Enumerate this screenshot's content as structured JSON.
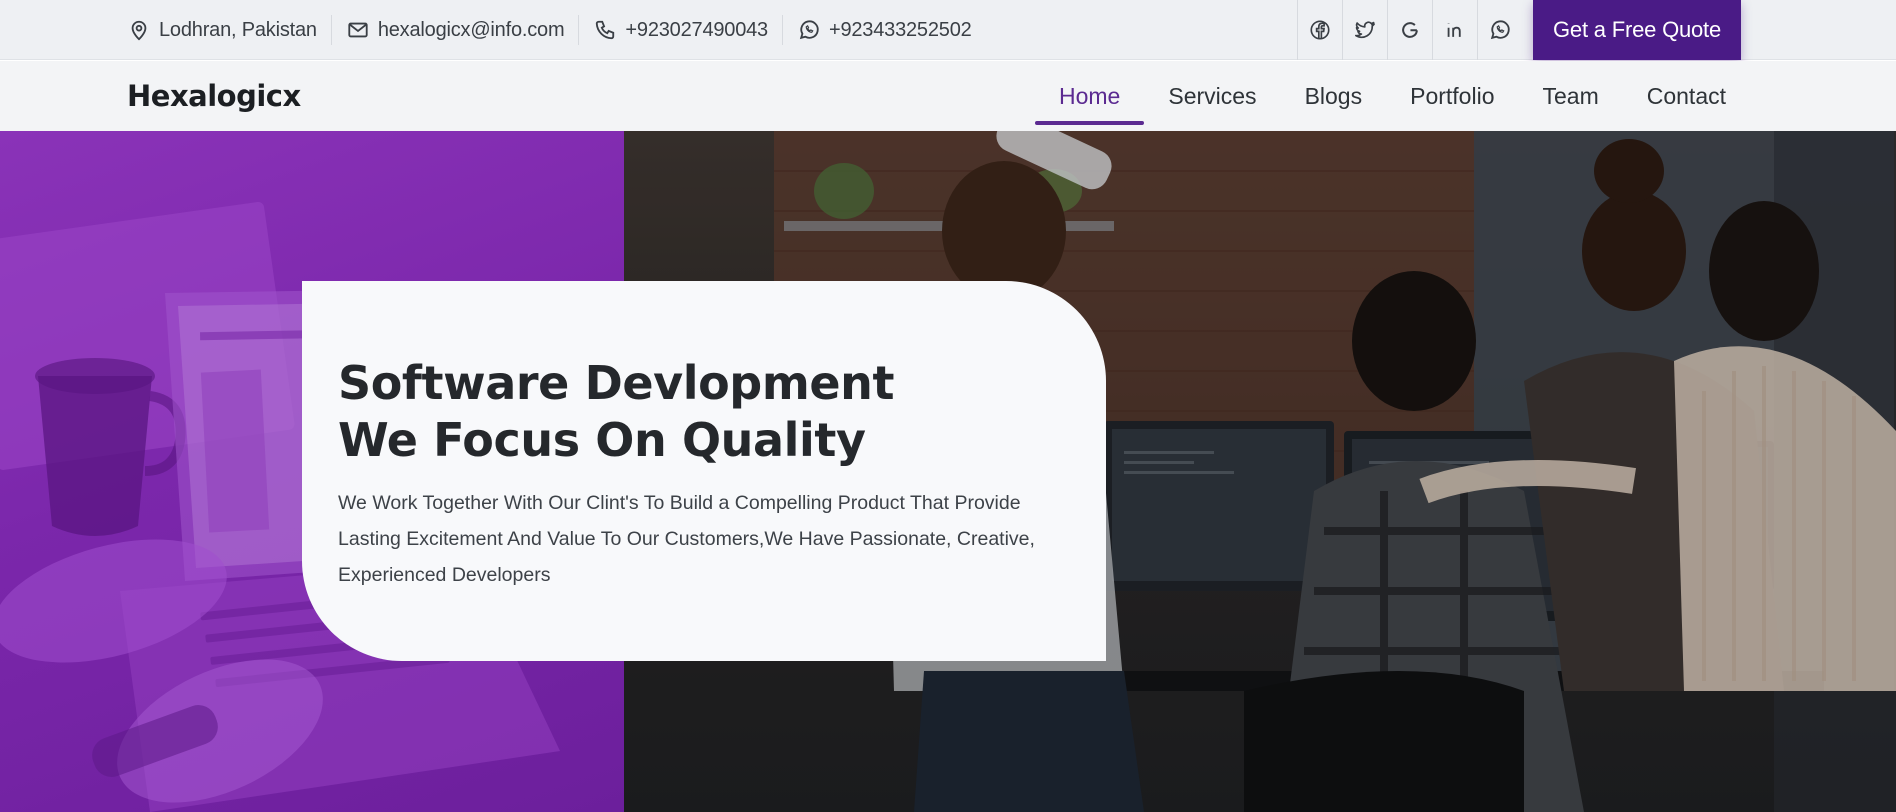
{
  "topbar": {
    "contacts": [
      {
        "icon": "map-pin-icon",
        "text": "Lodhran, Pakistan"
      },
      {
        "icon": "envelope-icon",
        "text": "hexalogicx@info.com"
      },
      {
        "icon": "phone-icon",
        "text": "+923027490043"
      },
      {
        "icon": "whatsapp-icon",
        "text": "+923433252502"
      }
    ],
    "social": [
      "facebook-icon",
      "twitter-icon",
      "google-icon",
      "linkedin-icon",
      "whatsapp-icon"
    ],
    "quote_label": "Get a Free Quote"
  },
  "nav": {
    "brand": "Hexalogicx",
    "links": [
      {
        "label": "Home",
        "active": true
      },
      {
        "label": "Services",
        "active": false
      },
      {
        "label": "Blogs",
        "active": false
      },
      {
        "label": "Portfolio",
        "active": false
      },
      {
        "label": "Team",
        "active": false
      },
      {
        "label": "Contact",
        "active": false
      }
    ]
  },
  "hero": {
    "title_line1": "Software Devlopment",
    "title_line2": "We Focus On Quality",
    "description": "We Work Together With Our Clint's To Build a Compelling Product That Provide Lasting Excitement And Value To Our Customers,We Have Passionate, Creative, Experienced Developers"
  },
  "colors": {
    "brand_purple": "#4a1b86",
    "accent_purple": "#5b2a91",
    "hero_overlay": "#7b27ab"
  }
}
